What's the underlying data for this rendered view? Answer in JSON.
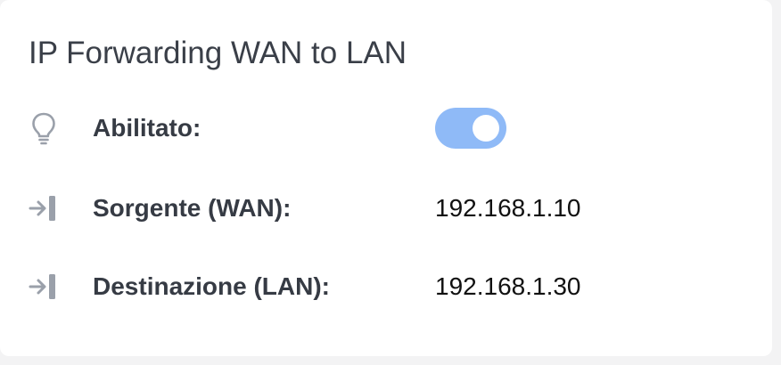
{
  "panel": {
    "title": "IP Forwarding WAN to LAN"
  },
  "rows": {
    "enabled": {
      "label": "Abilitato:",
      "icon": "lightbulb-icon",
      "value": true
    },
    "source": {
      "label": "Sorgente (WAN):",
      "icon": "sign-in-icon",
      "value": "192.168.1.10"
    },
    "destination": {
      "label": "Destinazione (LAN):",
      "icon": "sign-in-icon",
      "value": "192.168.1.30"
    }
  },
  "colors": {
    "toggle_on": "#8fbaf7",
    "icon": "#9aa0aa",
    "label": "#363b44"
  }
}
